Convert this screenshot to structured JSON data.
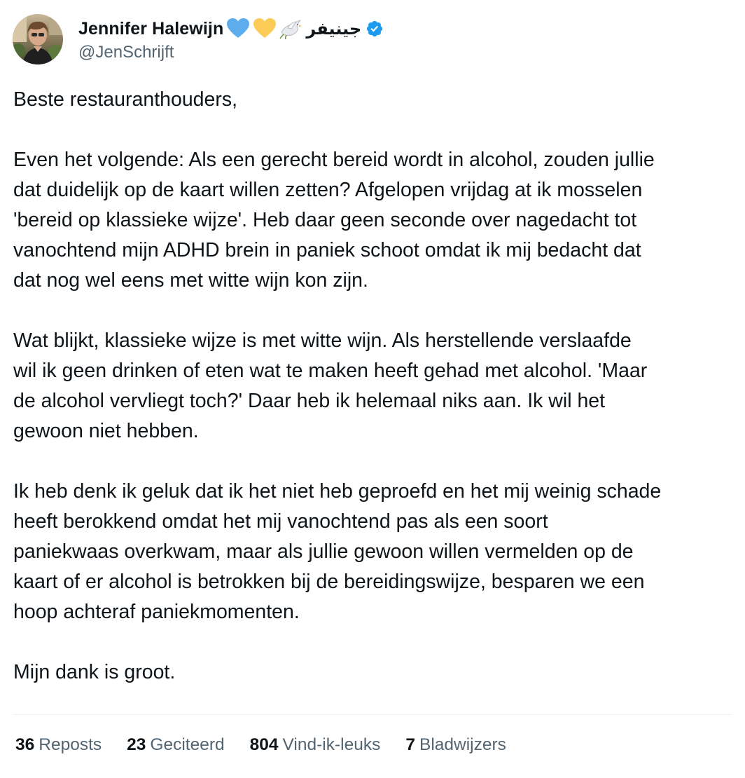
{
  "author": {
    "display_name": "Jennifer Halewijn",
    "emojis": [
      "blue-heart-icon",
      "yellow-heart-icon",
      "dove-icon"
    ],
    "arabic_name": "جينيفر",
    "verified": true,
    "handle": "@JenSchrijft"
  },
  "tweet": {
    "paragraphs": [
      "Beste restauranthouders,",
      "Even het volgende: Als een gerecht bereid wordt in alcohol, zouden jullie\ndat duidelijk op de kaart willen zetten? Afgelopen vrijdag at ik mosselen\n'bereid op klassieke wijze'. Heb daar geen seconde over nagedacht tot\nvanochtend mijn ADHD brein in paniek schoot omdat ik mij bedacht dat\ndat nog wel eens met witte wijn kon zijn.",
      "Wat blijkt, klassieke wijze is met witte wijn. Als herstellende verslaafde\nwil ik geen drinken of eten wat te maken heeft gehad met alcohol. 'Maar\nde alcohol vervliegt toch?' Daar heb ik helemaal niks aan. Ik wil het\ngewoon niet hebben.",
      "Ik heb denk ik geluk dat ik het niet heb geproefd en het mij weinig schade\nheeft berokkend omdat het mij vanochtend pas als een soort\npaniekwaas overkwam, maar als jullie gewoon willen vermelden op de\nkaart of er alcohol is betrokken bij de bereidingswijze, besparen we een\nhoop achteraf paniekmomenten.",
      "Mijn dank is groot."
    ]
  },
  "stats": {
    "reposts": {
      "value": "36",
      "label": "Reposts"
    },
    "quotes": {
      "value": "23",
      "label": "Geciteerd"
    },
    "likes": {
      "value": "804",
      "label": "Vind-ik-leuks"
    },
    "bookmarks": {
      "value": "7",
      "label": "Bladwijzers"
    }
  },
  "colors": {
    "text": "#0f1419",
    "secondary": "#536471",
    "verified_blue": "#1d9bf0",
    "divider": "#eff3f4"
  }
}
